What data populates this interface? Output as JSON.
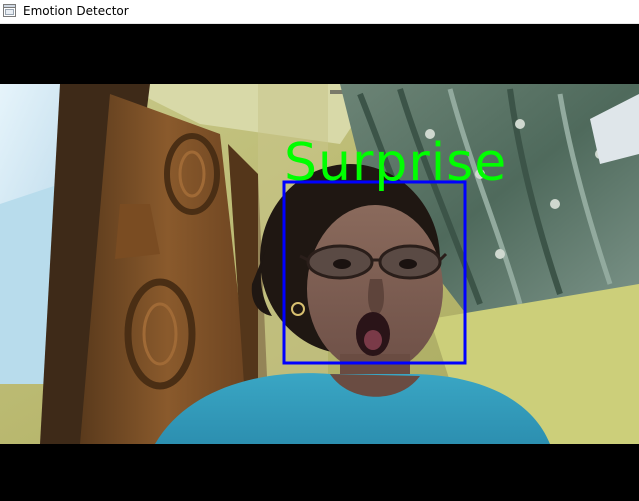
{
  "window": {
    "title": "Emotion Detector",
    "icon": "app-window-icon"
  },
  "detection": {
    "emotion_label": "Surprise",
    "label_color": "#00ff00",
    "box_color": "#0000ff"
  },
  "frame": {
    "letterbox_color": "#000000",
    "image_description": "webcam frame"
  }
}
